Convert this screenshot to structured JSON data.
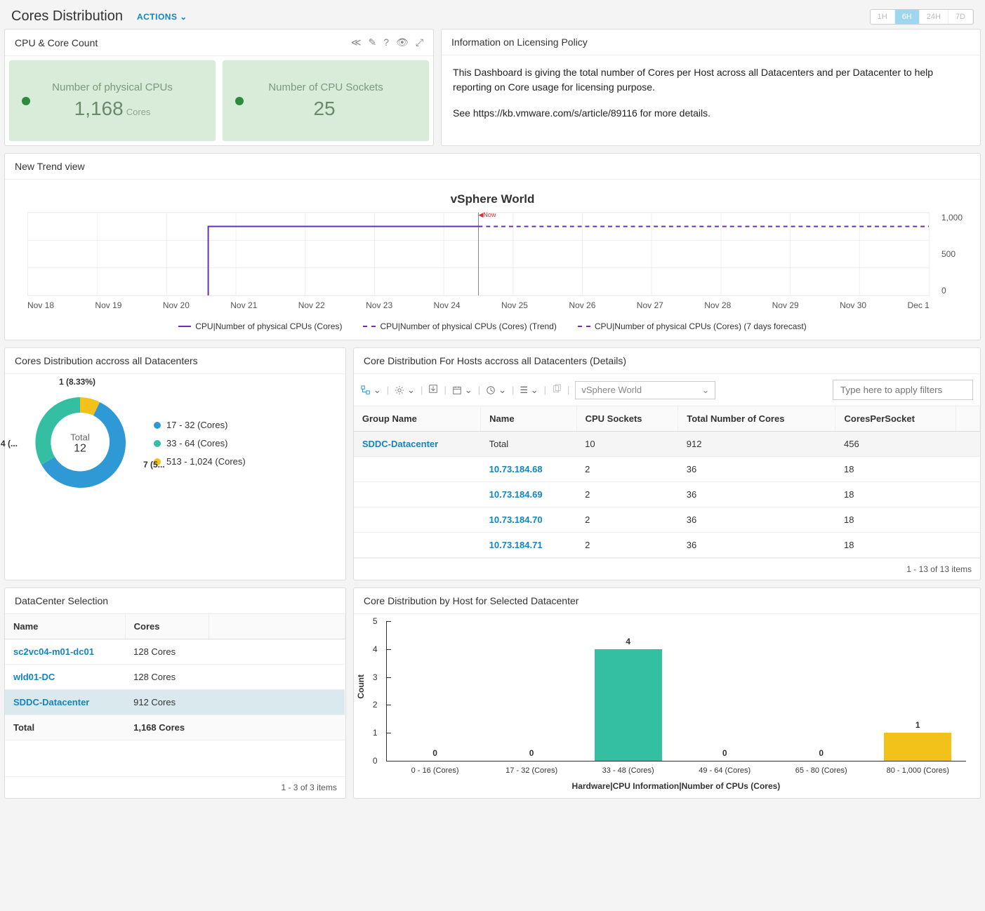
{
  "header": {
    "title": "Cores Distribution",
    "actions": "ACTIONS"
  },
  "time_ranges": [
    "1H",
    "6H",
    "24H",
    "7D"
  ],
  "time_active": "6H",
  "cpu_panel": {
    "title": "CPU & Core Count",
    "cards": [
      {
        "label": "Number of physical CPUs",
        "value": "1,168",
        "unit": "Cores"
      },
      {
        "label": "Number of CPU Sockets",
        "value": "25",
        "unit": ""
      }
    ]
  },
  "info_panel": {
    "title": "Information on Licensing Policy",
    "p1": "This Dashboard is giving the total number of Cores per Host across all Datacenters and per Datacenter to help reporting on Core usage for licensing purpose.",
    "p2": "See https://kb.vmware.com/s/article/89116 for more details."
  },
  "trend_panel": {
    "title": "New Trend view",
    "chart_title": "vSphere World",
    "now_label": "Now",
    "x_ticks": [
      "Nov 18",
      "Nov 19",
      "Nov 20",
      "Nov 21",
      "Nov 22",
      "Nov 23",
      "Nov 24",
      "Nov 25",
      "Nov 26",
      "Nov 27",
      "Nov 28",
      "Nov 29",
      "Nov 30",
      "Dec 1"
    ],
    "y_ticks": [
      "1,000",
      "500",
      "0"
    ],
    "legend": [
      "CPU|Number of physical CPUs (Cores)",
      "CPU|Number of physical CPUs (Cores) (Trend)",
      "CPU|Number of physical CPUs (Cores) (7 days forecast)"
    ]
  },
  "donut_panel": {
    "title": "Cores Distribution accross all Datacenters",
    "total_label": "Total",
    "total_value": "12",
    "labels": {
      "a": "1 (8.33%)",
      "b": "7 (5...",
      "c": "4 (..."
    },
    "legend": [
      {
        "color": "#2f99d6",
        "label": "17 - 32 (Cores)"
      },
      {
        "color": "#35bfa2",
        "label": "33 - 64 (Cores)"
      },
      {
        "color": "#f2c21a",
        "label": "513 - 1,024 (Cores)"
      }
    ]
  },
  "details_panel": {
    "title": "Core Distribution For Hosts accross all Datacenters (Details)",
    "scope": "vSphere World",
    "filter_placeholder": "Type here to apply filters",
    "columns": [
      "Group Name",
      "Name",
      "CPU Sockets",
      "Total Number of Cores",
      "CoresPerSocket"
    ],
    "rows": [
      {
        "group": "SDDC-Datacenter",
        "name": "Total",
        "sockets": "10",
        "cores": "912",
        "cps": "456",
        "grouplink": true,
        "bold": true
      },
      {
        "group": "",
        "name": "10.73.184.68",
        "sockets": "2",
        "cores": "36",
        "cps": "18",
        "namelink": true
      },
      {
        "group": "",
        "name": "10.73.184.69",
        "sockets": "2",
        "cores": "36",
        "cps": "18",
        "namelink": true
      },
      {
        "group": "",
        "name": "10.73.184.70",
        "sockets": "2",
        "cores": "36",
        "cps": "18",
        "namelink": true
      },
      {
        "group": "",
        "name": "10.73.184.71",
        "sockets": "2",
        "cores": "36",
        "cps": "18",
        "namelink": true
      }
    ],
    "footer": "1 - 13 of 13 items"
  },
  "dc_panel": {
    "title": "DataCenter Selection",
    "columns": [
      "Name",
      "Cores"
    ],
    "rows": [
      {
        "name": "sc2vc04-m01-dc01",
        "cores": "128 Cores"
      },
      {
        "name": "wld01-DC",
        "cores": "128 Cores"
      },
      {
        "name": "SDDC-Datacenter",
        "cores": "912 Cores",
        "selected": true
      }
    ],
    "total": {
      "name": "Total",
      "cores": "1,168 Cores"
    },
    "footer": "1 - 3 of 3 items"
  },
  "bar_panel": {
    "title": "Core Distribution by Host for Selected Datacenter",
    "ylabel": "Count",
    "xlabel": "Hardware|CPU Information|Number of CPUs (Cores)",
    "ymax": 5
  },
  "chart_data": [
    {
      "type": "line",
      "title": "vSphere World",
      "x": [
        "Nov 18",
        "Nov 19",
        "Nov 20",
        "Nov 21",
        "Nov 22",
        "Nov 23",
        "Nov 24",
        "Nov 25",
        "Nov 26",
        "Nov 27",
        "Nov 28",
        "Nov 29",
        "Nov 30",
        "Dec 1"
      ],
      "series": [
        {
          "name": "CPU|Number of physical CPUs (Cores)",
          "values": [
            null,
            null,
            null,
            1168,
            1168,
            1168,
            1168,
            null,
            null,
            null,
            null,
            null,
            null,
            null
          ]
        },
        {
          "name": "CPU|Number of physical CPUs (Cores) (Trend)",
          "values": [
            null,
            null,
            null,
            null,
            null,
            null,
            1168,
            1168,
            1168,
            1168,
            1168,
            1168,
            1168,
            1168
          ]
        },
        {
          "name": "CPU|Number of physical CPUs (Cores) (7 days forecast)",
          "values": [
            null,
            null,
            null,
            null,
            null,
            null,
            1168,
            1168,
            1168,
            1168,
            1168,
            1168,
            1168,
            1168
          ]
        }
      ],
      "ylim": [
        0,
        1200
      ]
    },
    {
      "type": "pie",
      "title": "Cores Distribution accross all Datacenters",
      "slices": [
        {
          "label": "17 - 32 (Cores)",
          "value": 7,
          "color": "#2f99d6"
        },
        {
          "label": "33 - 64 (Cores)",
          "value": 4,
          "color": "#35bfa2"
        },
        {
          "label": "513 - 1,024 (Cores)",
          "value": 1,
          "color": "#f2c21a"
        }
      ],
      "total": 12
    },
    {
      "type": "bar",
      "title": "Core Distribution by Host for Selected Datacenter",
      "categories": [
        "0 - 16 (Cores)",
        "17 - 32 (Cores)",
        "33 - 48 (Cores)",
        "49 - 64 (Cores)",
        "65 - 80 (Cores)",
        "80 - 1,000 (Cores)"
      ],
      "values": [
        0,
        0,
        4,
        0,
        0,
        1
      ],
      "colors": [
        "#35bfa2",
        "#35bfa2",
        "#35bfa2",
        "#35bfa2",
        "#35bfa2",
        "#f2c21a"
      ],
      "ylabel": "Count",
      "ylim": [
        0,
        5
      ]
    }
  ]
}
